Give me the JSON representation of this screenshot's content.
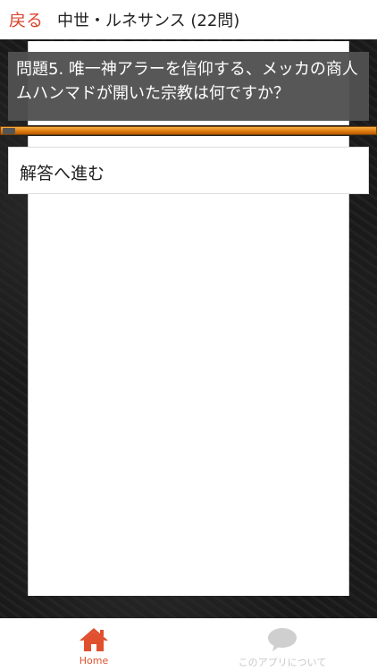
{
  "header": {
    "back_label": "戻る",
    "title": "中世・ルネサンス (22問)"
  },
  "quiz": {
    "question": "問題5. 唯一神アラーを信仰する、メッカの商人ムハンマドが開いた宗教は何ですか？",
    "progress_fraction": 1.0,
    "answer_button_label": "解答へ進む"
  },
  "tabs": [
    {
      "label": "Home",
      "icon": "home-icon",
      "active": true
    },
    {
      "label": "このアプリについて",
      "icon": "speech-bubble-icon",
      "active": false
    }
  ],
  "colors": {
    "accent": "#e0502e",
    "back_link": "#d9442c",
    "progress": "#e07c0e",
    "inactive_tab": "#c8c8c8"
  }
}
